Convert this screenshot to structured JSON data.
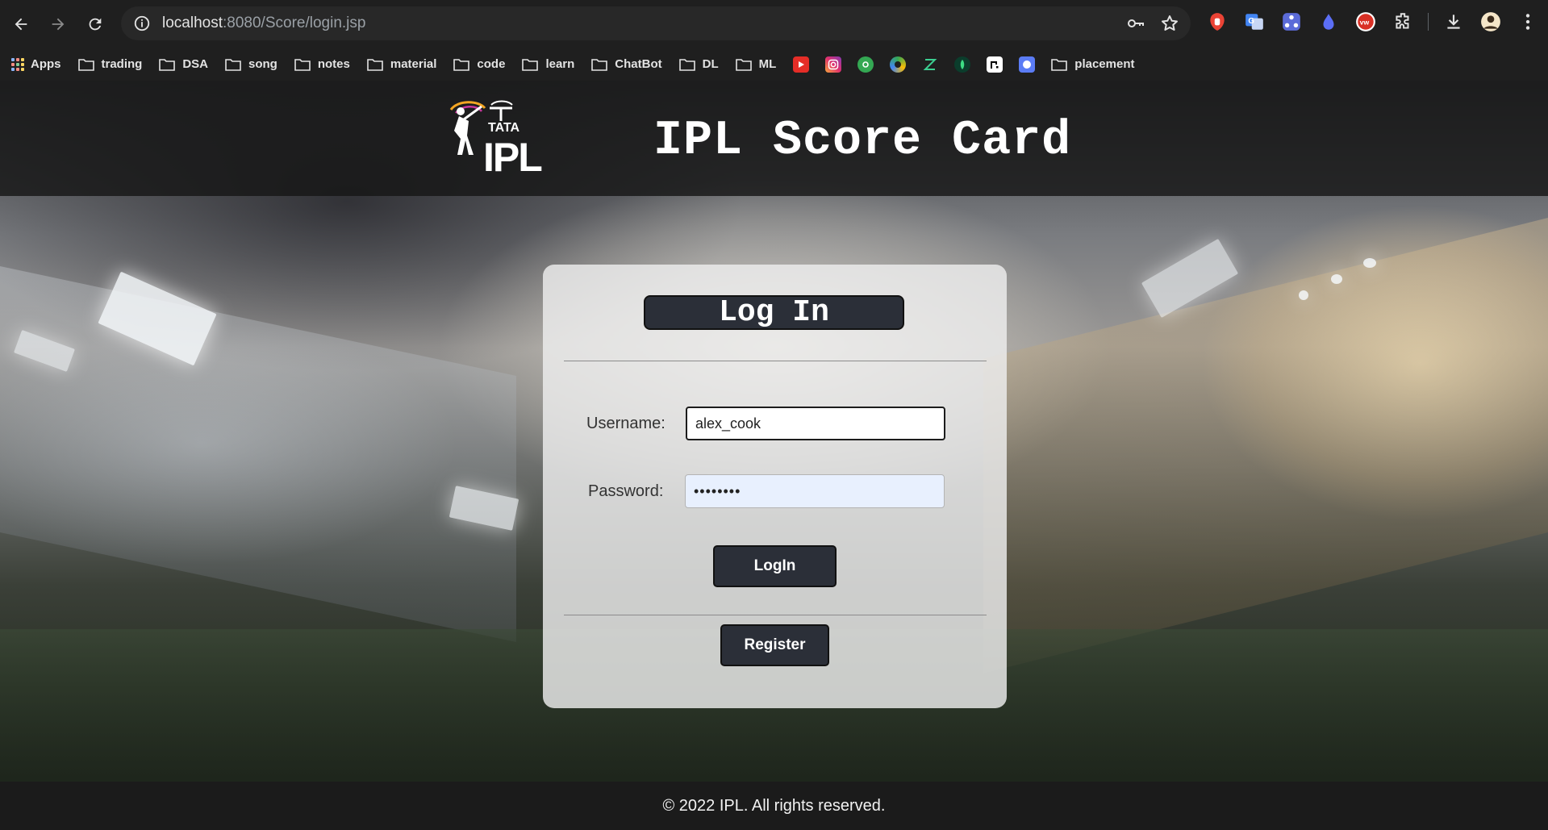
{
  "browser": {
    "url_host": "localhost",
    "url_path": ":8080/Score/login.jsp",
    "bookmarks": {
      "apps": "Apps",
      "folders": [
        "trading",
        "DSA",
        "song",
        "notes",
        "material",
        "code",
        "learn",
        "ChatBot",
        "DL",
        "ML"
      ],
      "last_folder": "placement"
    }
  },
  "header": {
    "logo_text_top": "TATA",
    "logo_text_main": "IPL",
    "title": "IPL Score Card"
  },
  "login_card": {
    "title": "Log In",
    "username_label": "Username:",
    "username_value": "alex_cook",
    "password_label": "Password:",
    "password_value": "••••••••",
    "login_button": "LogIn",
    "register_button": "Register"
  },
  "footer": {
    "text": "© 2022 IPL. All rights reserved."
  }
}
